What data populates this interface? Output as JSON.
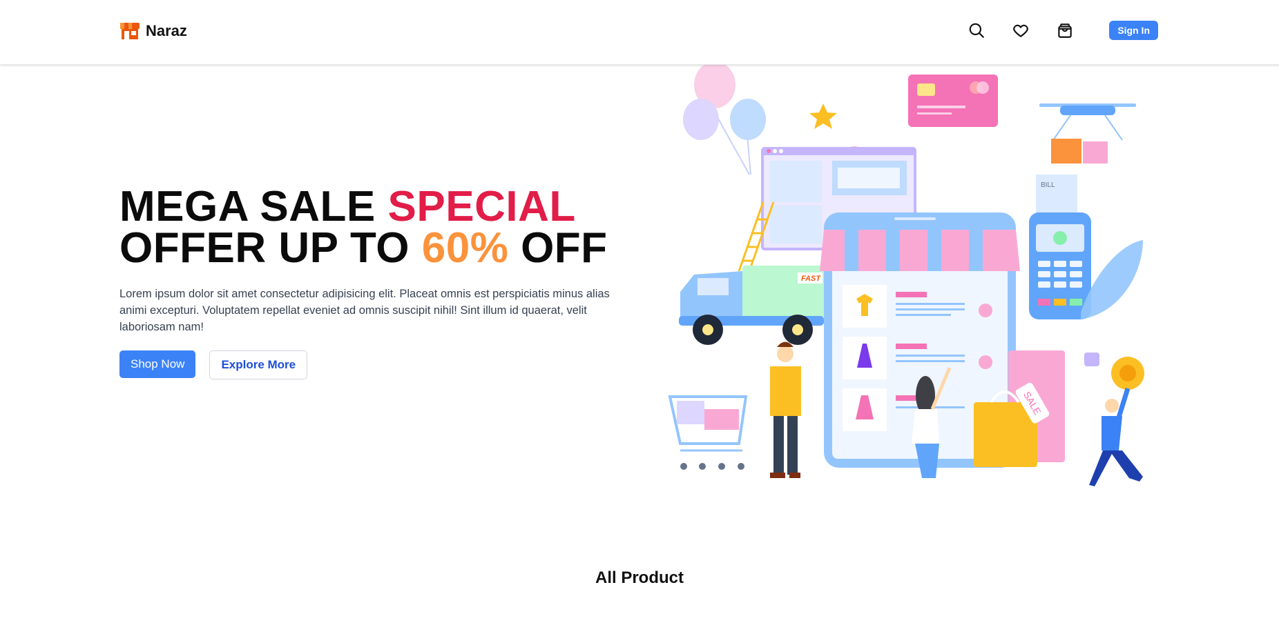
{
  "brand": {
    "name": "Naraz",
    "logo_icon": "storefront-icon",
    "logo_color": "#ea580c"
  },
  "nav": {
    "icons": [
      "search-icon",
      "heart-icon",
      "shopping-bag-icon"
    ],
    "signin_label": "Sign In"
  },
  "hero": {
    "headline_part1": "MEGA SALE ",
    "headline_highlight1": "SPECIAL",
    "headline_part2": "OFFER UP TO ",
    "headline_highlight2": "60%",
    "headline_part3": " OFF",
    "description": "Lorem ipsum dolor sit amet consectetur adipisicing elit. Placeat omnis est perspiciatis minus alias animi excepturi. Voluptatem repellat eveniet ad omnis suscipit nihil! Sint illum id quaerat, velit laboriosam nam!",
    "primary_button": "Shop Now",
    "secondary_button": "Explore More",
    "illustration": {
      "truck_label": "FAST",
      "bill_label": "BILL",
      "tag_label": "SALE"
    }
  },
  "products": {
    "title": "All Product"
  },
  "colors": {
    "accent": "#3b82f6",
    "highlight_red": "#e11d48",
    "highlight_orange": "#fb923c"
  }
}
